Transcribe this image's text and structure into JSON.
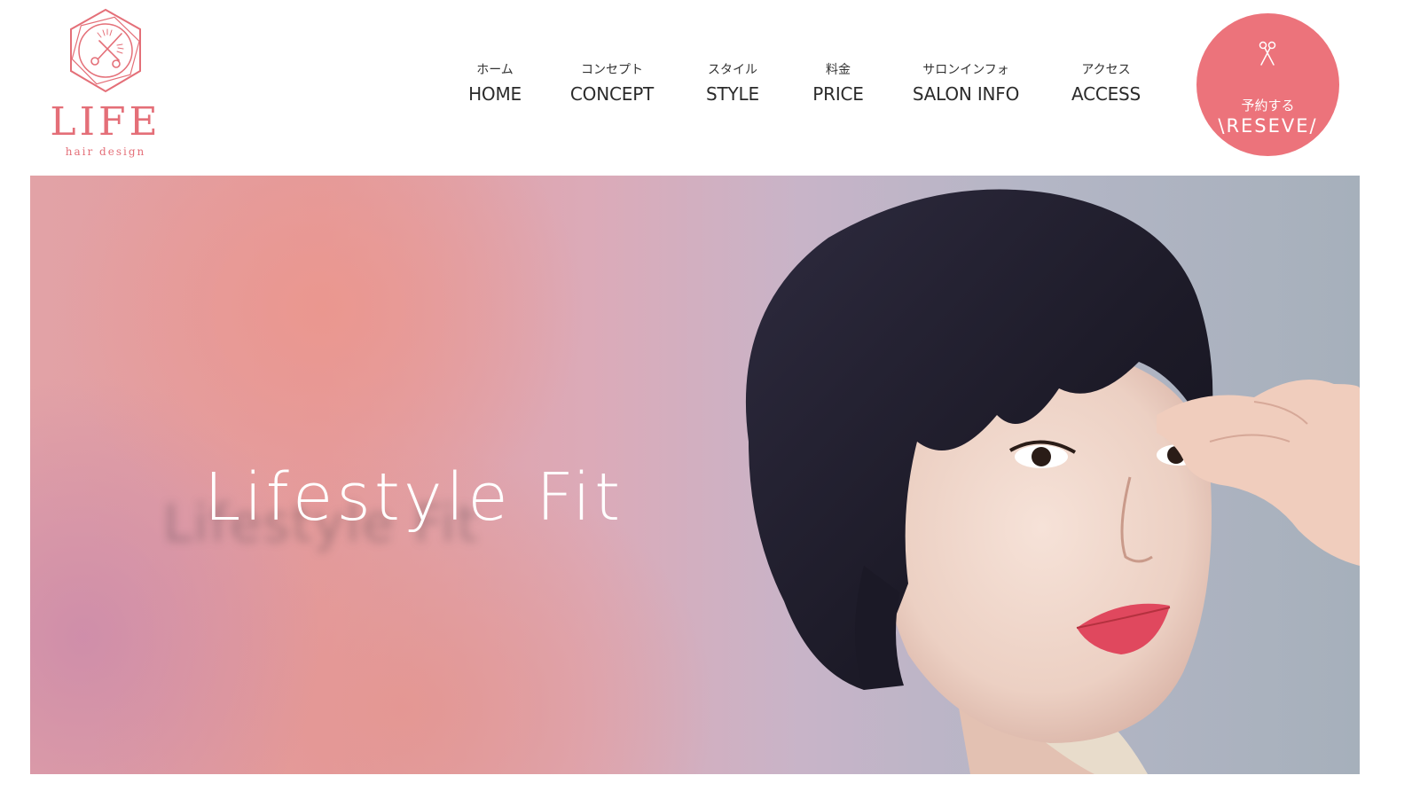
{
  "brand": {
    "name": "LIFE",
    "tagline": "hair design",
    "color": "#e46f78"
  },
  "nav": [
    {
      "jp": "ホーム",
      "en": "HOME"
    },
    {
      "jp": "コンセプト",
      "en": "CONCEPT"
    },
    {
      "jp": "スタイル",
      "en": "STYLE"
    },
    {
      "jp": "料金",
      "en": "PRICE"
    },
    {
      "jp": "サロンインフォ",
      "en": "SALON INFO"
    },
    {
      "jp": "アクセス",
      "en": "ACCESS"
    }
  ],
  "reserve": {
    "icon": "scissors-icon",
    "jp": "予約する",
    "en": "\\RESEVE/",
    "color": "#ec737b"
  },
  "hero": {
    "title": "Lifestyle Fit",
    "title_shadow": "Lifestyle Fit"
  }
}
